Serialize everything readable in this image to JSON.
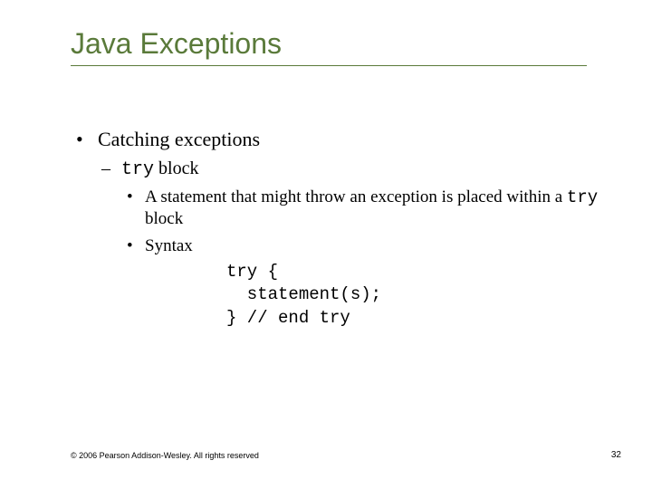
{
  "title": "Java Exceptions",
  "bullet1": "Catching exceptions",
  "sub1_code": "try",
  "sub1_rest": " block",
  "sub1a_pre": "A statement that might throw an exception is placed within a ",
  "sub1a_code": "try",
  "sub1a_post": " block",
  "sub1b": "Syntax",
  "code_line1": "try {",
  "code_line2": "  statement(s);",
  "code_line3": "} // end try",
  "footer_left": "© 2006 Pearson Addison-Wesley. All rights reserved",
  "footer_right": "32"
}
